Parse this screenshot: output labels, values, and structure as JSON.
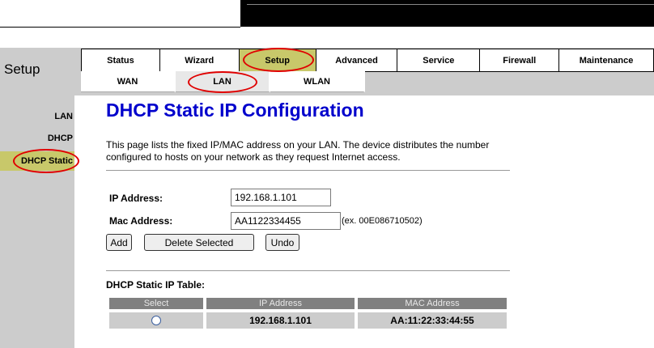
{
  "header": {
    "title": "Setup"
  },
  "main_tabs": [
    {
      "label": "Status"
    },
    {
      "label": "Wizard"
    },
    {
      "label": "Setup"
    },
    {
      "label": "Advanced"
    },
    {
      "label": "Service"
    },
    {
      "label": "Firewall"
    },
    {
      "label": "Maintenance"
    }
  ],
  "active_main_tab": "Setup",
  "sub_tabs": [
    {
      "label": "WAN"
    },
    {
      "label": "LAN"
    },
    {
      "label": "WLAN"
    }
  ],
  "active_sub_tab": "LAN",
  "sidebar": {
    "items": [
      {
        "label": "LAN"
      },
      {
        "label": "DHCP"
      },
      {
        "label": "DHCP Static"
      }
    ],
    "active": "DHCP Static"
  },
  "page": {
    "title": "DHCP Static IP Configuration",
    "description": "This page lists the fixed IP/MAC address on your LAN. The device distributes the number configured to hosts on your network as they request Internet access."
  },
  "form": {
    "ip_label": "IP Address:",
    "ip_value": "192.168.1.101",
    "mac_label": "Mac Address:",
    "mac_value": "AA1122334455",
    "mac_hint": "(ex. 00E086710502)",
    "add_label": "Add",
    "delete_label": "Delete Selected",
    "undo_label": "Undo"
  },
  "table": {
    "title": "DHCP Static IP Table:",
    "headers": [
      "Select",
      "IP Address",
      "MAC Address"
    ],
    "rows": [
      {
        "selected": false,
        "ip": "192.168.1.101",
        "mac": "AA:11:22:33:44:55"
      }
    ]
  },
  "colors": {
    "title_blue": "#0000cc",
    "active_tab": "#c8c86a",
    "highlight_ellipse": "#e00000",
    "band_gray": "#cccccc",
    "table_header": "#808080"
  }
}
